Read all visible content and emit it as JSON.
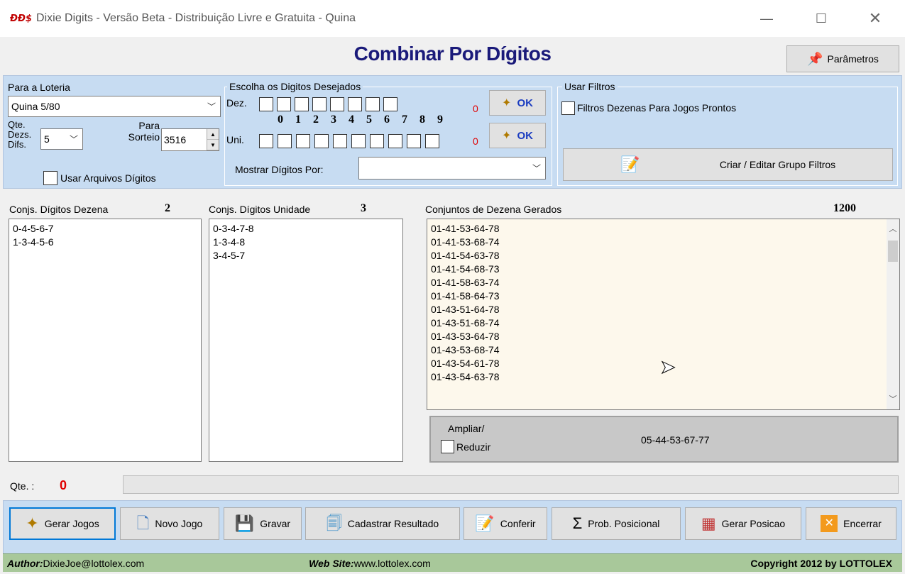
{
  "window": {
    "logo": "ÐÐ$",
    "title": "Dixie Digits - Versão Beta - Distribuição Livre e Gratuita  - Quina",
    "min": "—",
    "max": "☐",
    "close": "✕"
  },
  "heading": "Combinar Por Dígitos",
  "params_button": "Parâmetros",
  "loteria": {
    "legend": "Para a Loteria",
    "selected": "Quina 5/80",
    "qte_label_1": "Qte.",
    "qte_label_2": "Dezs.",
    "qte_label_3": "Difs.",
    "qte_value": "5",
    "sorteio_label_1": "Para",
    "sorteio_label_2": "Sorteio",
    "sorteio_value": "3516",
    "arquivos_label": "Usar Arquivos Dígitos"
  },
  "digitos": {
    "legend": "Escolha os Digitos Desejados",
    "dez_label": "Dez.",
    "uni_label": "Uni.",
    "digits": [
      "0",
      "1",
      "2",
      "3",
      "4",
      "5",
      "6",
      "7",
      "8",
      "9"
    ],
    "dez_count": "0",
    "uni_count": "0",
    "ok_label": "OK",
    "mostrar_label": "Mostrar Dígitos Por:",
    "mostrar_value": ""
  },
  "filtros": {
    "legend": "Usar Filtros",
    "checkbox_label": "Filtros Dezenas Para Jogos Prontos",
    "button_label": "Criar / Editar Grupo Filtros"
  },
  "lists": {
    "dezena": {
      "title": "Conjs. Dígitos Dezena",
      "count": "2",
      "items": [
        "0-4-5-6-7",
        "1-3-4-5-6"
      ]
    },
    "unidade": {
      "title": "Conjs. Dígitos Unidade",
      "count": "3",
      "items": [
        "0-3-4-7-8",
        "1-3-4-8",
        "3-4-5-7"
      ]
    },
    "gerados": {
      "title": "Conjuntos de Dezena Gerados",
      "count": "1200",
      "items": [
        "01-41-53-64-78",
        "01-41-53-68-74",
        "01-41-54-63-78",
        "01-41-54-68-73",
        "01-41-58-63-74",
        "01-41-58-64-73",
        "01-43-51-64-78",
        "01-43-51-68-74",
        "01-43-53-64-78",
        "01-43-53-68-74",
        "01-43-54-61-78",
        "01-43-54-63-78"
      ]
    }
  },
  "ampliar": {
    "label_1": "Ampliar/",
    "label_2": "Reduzir",
    "value": "05-44-53-67-77"
  },
  "qte": {
    "label": "Qte. :",
    "value": "0"
  },
  "toolbar": {
    "gerar": "Gerar Jogos",
    "novo": "Novo Jogo",
    "gravar": "Gravar",
    "cadastrar": "Cadastrar Resultado",
    "conferir": "Conferir",
    "prob": "Prob. Posicional",
    "gerar_pos": "Gerar Posicao",
    "encerrar": "Encerrar"
  },
  "footer": {
    "author_label": "Author:",
    "author_value": " DixieJoe@lottolex.com",
    "site_label": "Web Site:",
    "site_value": " www.lottolex.com",
    "copyright": "Copyright 2012 by LOTTOLEX"
  }
}
